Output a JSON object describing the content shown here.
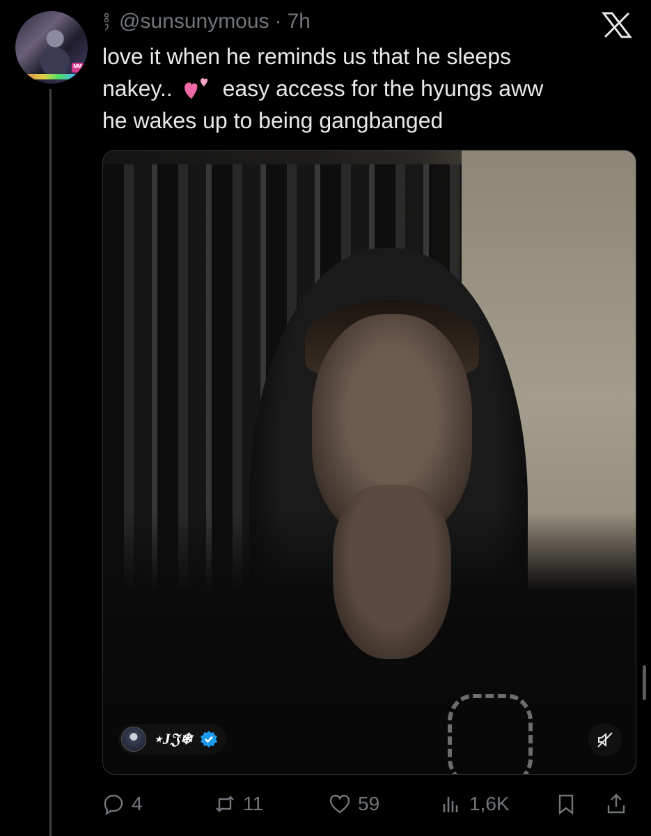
{
  "post": {
    "handle": "@sunsunymous",
    "separator": "·",
    "time": "7h",
    "text_line1": "love it when he reminds us that he sleeps",
    "text_line2_a": "nakey..",
    "text_line2_b": "easy access for the hyungs aww",
    "text_line3": "he wakes up to being gangbanged"
  },
  "media": {
    "overlay_username": "⋆J𝔍❄",
    "verified": true
  },
  "actions": {
    "replies": "4",
    "reposts": "11",
    "likes": "59",
    "views": "1,6K"
  },
  "icons": {
    "close": "x-logo-icon",
    "reply": "reply-icon",
    "repost": "repost-icon",
    "like": "heart-icon",
    "views": "views-icon",
    "bookmark": "bookmark-icon",
    "share": "share-icon",
    "mute": "mute-icon",
    "emoji": "two-hearts-emoji"
  },
  "colors": {
    "background": "#000000",
    "text": "#e7e9ea",
    "muted": "#71767b",
    "verified": "#1d9bf0",
    "emoji_pink": "#f06aa8"
  }
}
